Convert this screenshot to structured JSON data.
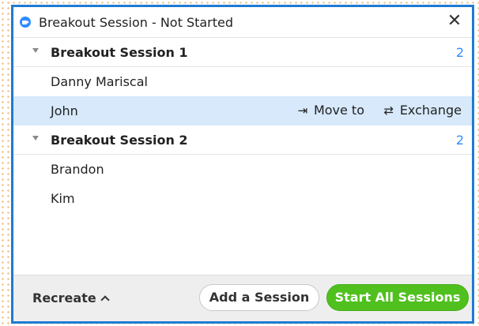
{
  "window": {
    "title": "Breakout Session - Not Started",
    "close_glyph": "✕"
  },
  "sessions": [
    {
      "name": "Breakout Session 1",
      "count": "2",
      "participants": [
        {
          "name": "Danny Mariscal"
        },
        {
          "name": "John",
          "selected": true
        }
      ]
    },
    {
      "name": "Breakout Session 2",
      "count": "2",
      "participants": [
        {
          "name": "Brandon"
        },
        {
          "name": "Kim"
        }
      ]
    }
  ],
  "row_actions": {
    "move_icon": "⇥",
    "move_label": "Move to",
    "exchange_icon": "⇄",
    "exchange_label": "Exchange"
  },
  "footer": {
    "recreate_label": "Recreate",
    "add_session_label": "Add a Session",
    "start_all_label": "Start All Sessions"
  },
  "colors": {
    "accent": "#2d8cff",
    "window_border": "#1e7bd4",
    "selected_row": "#d7e9fb",
    "start_button": "#4fc01d"
  }
}
